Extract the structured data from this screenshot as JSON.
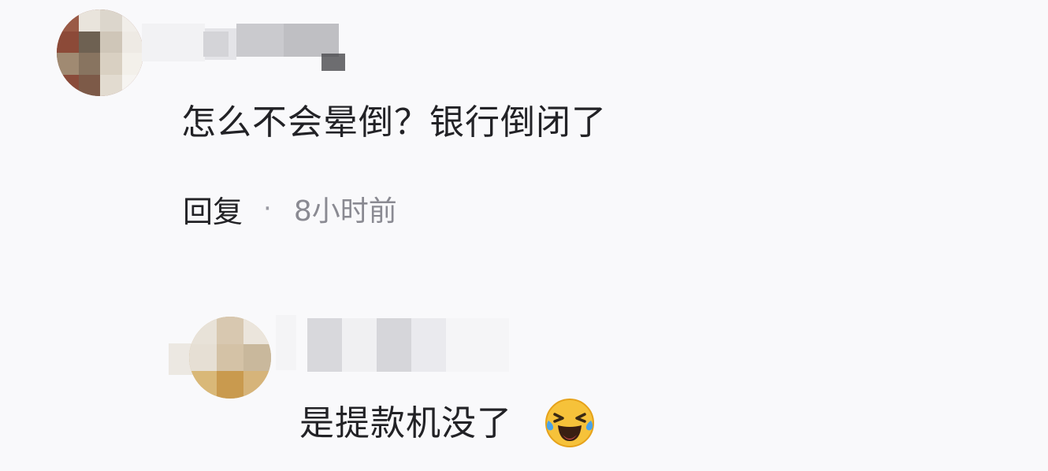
{
  "comments": [
    {
      "text": "怎么不会晕倒？银行倒闭了",
      "actions": {
        "reply_label": "回复",
        "separator": "·",
        "time_ago": "8小时前"
      }
    },
    {
      "text": "是提款机没了",
      "emoji": "laugh-crying-emoji"
    }
  ]
}
